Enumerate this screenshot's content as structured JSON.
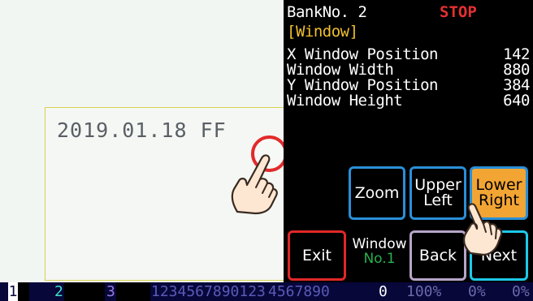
{
  "camera_view": {
    "printed_text": "2019.01.18 FF"
  },
  "panel": {
    "bank_label": "BankNo. 2",
    "state": "STOP",
    "section": "[Window]",
    "params": [
      {
        "label": "X Window Position",
        "value": "142"
      },
      {
        "label": "Window Width",
        "value": "880"
      },
      {
        "label": "Y Window Position",
        "value": "384"
      },
      {
        "label": "Window Height",
        "value": "640"
      }
    ],
    "buttons": {
      "zoom": "Zoom",
      "upper_left_1": "Upper",
      "upper_left_2": "Left",
      "lower_right_1": "Lower",
      "lower_right_2": "Right",
      "exit": "Exit",
      "window_label": "Window",
      "window_no": "No.1",
      "back": "Back",
      "next": "Next"
    }
  },
  "status_bar": {
    "slot1": "1",
    "slot2": "2",
    "slot3": "3",
    "counter": "1234567890123",
    "counter2": "4567890",
    "count": "0",
    "pct1": "100%",
    "pct2": "0%",
    "pct3": "0%"
  },
  "colors": {
    "stop": "#e53030",
    "section": "#f0c030",
    "button_blue": "#2a8fd8",
    "button_selected": "#f2a533",
    "exit_border": "#e02828",
    "window_no": "#28b050"
  }
}
